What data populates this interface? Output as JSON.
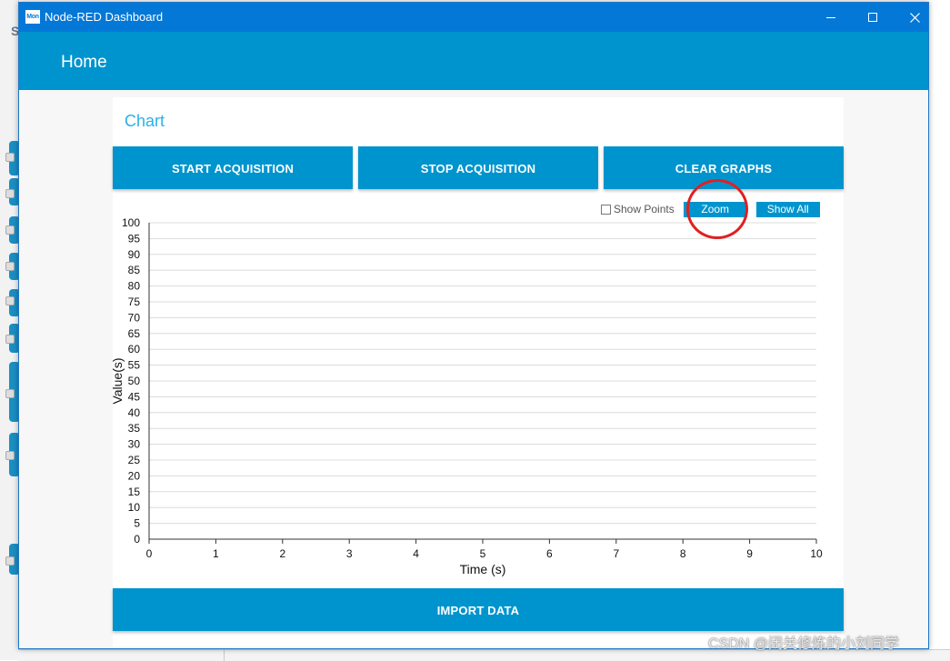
{
  "window": {
    "title": "Node-RED Dashboard",
    "app_icon_text": "Mon",
    "controls": [
      "minimize",
      "maximize",
      "close"
    ]
  },
  "toolbar": {
    "title": "Home"
  },
  "card": {
    "title": "Chart",
    "buttons": {
      "start": "START ACQUISITION",
      "stop": "STOP ACQUISITION",
      "clear": "CLEAR GRAPHS",
      "import": "IMPORT DATA"
    },
    "chart_controls": {
      "show_points_label": "Show Points",
      "show_points_checked": false,
      "zoom_label": "Zoom",
      "show_all_label": "Show All"
    }
  },
  "chart_data": {
    "type": "line",
    "series": [],
    "xlabel": "Time (s)",
    "ylabel": "Value(s)",
    "xlim": [
      0,
      10
    ],
    "ylim": [
      0,
      100
    ],
    "x_ticks": [
      0,
      1,
      2,
      3,
      4,
      5,
      6,
      7,
      8,
      9,
      10
    ],
    "y_ticks": [
      0,
      5,
      10,
      15,
      20,
      25,
      30,
      35,
      40,
      45,
      50,
      55,
      60,
      65,
      70,
      75,
      80,
      85,
      90,
      95,
      100
    ],
    "grid": "horizontal"
  },
  "annotation": {
    "highlight_target": "Zoom",
    "color": "#e02020"
  },
  "background": {
    "left_letter": "S"
  },
  "watermark": "CSDN @闭关修炼的小刘同学",
  "colors": {
    "titlebar": "#0478d7",
    "accent": "#0094ce",
    "card_title": "#2bb0e8"
  }
}
